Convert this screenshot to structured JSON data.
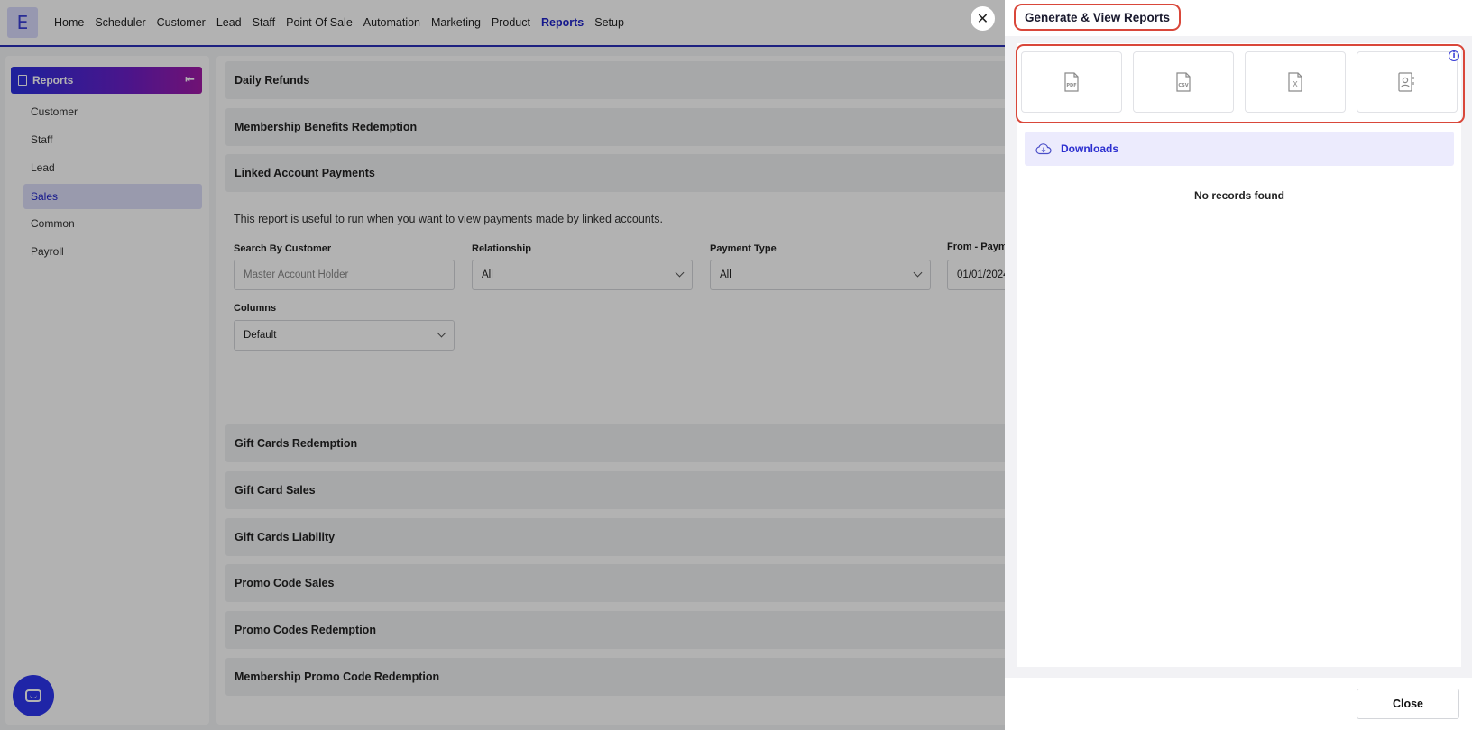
{
  "app": {
    "logo_letter": "E"
  },
  "nav": {
    "items": [
      "Home",
      "Scheduler",
      "Customer",
      "Lead",
      "Staff",
      "Point Of Sale",
      "Automation",
      "Marketing",
      "Product",
      "Reports",
      "Setup"
    ],
    "active": "Reports"
  },
  "sidebar": {
    "title": "Reports",
    "items": [
      "Customer",
      "Staff",
      "Lead",
      "Sales",
      "Common",
      "Payroll"
    ],
    "active": "Sales"
  },
  "main": {
    "sections_top": [
      "Daily Refunds",
      "Membership Benefits Redemption",
      "Linked Account Payments"
    ],
    "description": "This report is useful to run when you want to view payments made by linked accounts.",
    "filters": {
      "customer_label": "Search By Customer",
      "customer_placeholder": "Master Account Holder",
      "relationship_label": "Relationship",
      "relationship_value": "All",
      "payment_type_label": "Payment Type",
      "payment_type_value": "All",
      "from_label": "From - Payme",
      "from_value": "01/01/2024",
      "columns_label": "Columns",
      "columns_value": "Default"
    },
    "sections_bottom": [
      "Gift Cards Redemption",
      "Gift Card Sales",
      "Gift Cards Liability",
      "Promo Code Sales",
      "Promo Codes Redemption",
      "Membership Promo Code Redemption"
    ]
  },
  "drawer": {
    "title": "Generate & View Reports",
    "export_formats": [
      "pdf-icon",
      "csv-icon",
      "excel-icon",
      "contact-report-icon"
    ],
    "pdf_text": "PDF",
    "csv_text": "CSV",
    "excel_text": "X",
    "downloads_label": "Downloads",
    "empty_text": "No records found",
    "close_label": "Close"
  },
  "colors": {
    "accent": "#1f23c9",
    "highlight": "#d9473a",
    "downloads_bg": "#ecebfd"
  }
}
